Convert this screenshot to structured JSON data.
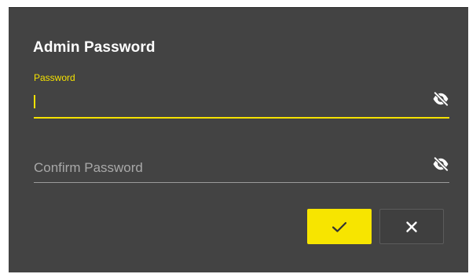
{
  "dialog": {
    "title": "Admin Password"
  },
  "password_field": {
    "label": "Password",
    "value": "",
    "state": "focused",
    "visibility_toggle_icon": "eye-off-icon"
  },
  "confirm_field": {
    "placeholder": "Confirm Password",
    "value": "",
    "visibility_toggle_icon": "eye-off-icon"
  },
  "buttons": {
    "confirm_icon": "check-icon",
    "cancel_icon": "close-icon"
  },
  "colors": {
    "accent": "#f5e200",
    "dialog_background": "#434343",
    "text": "#ffffff",
    "muted_text": "#a8a8a8"
  }
}
